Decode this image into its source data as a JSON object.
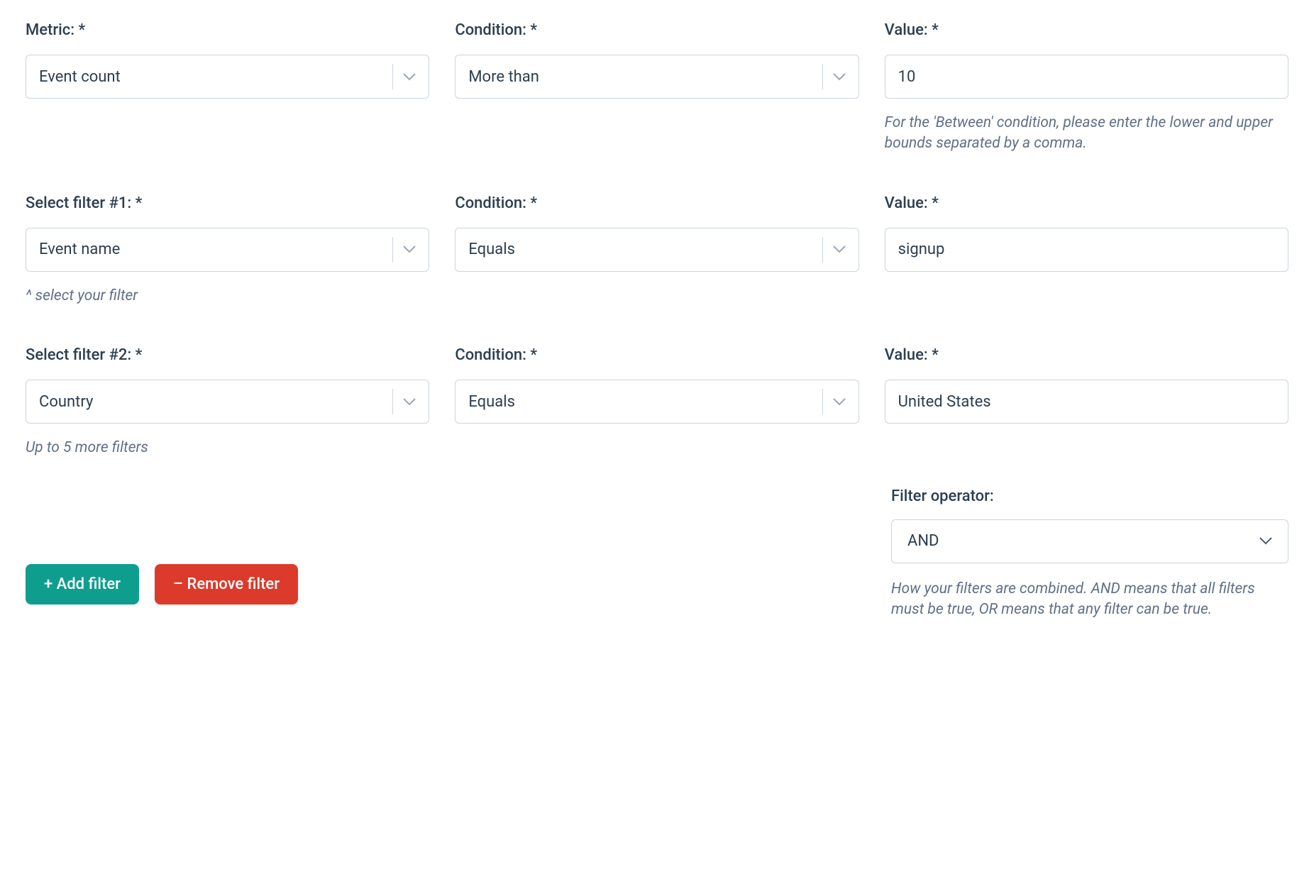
{
  "metric": {
    "label": "Metric: *",
    "value": "Event count",
    "condition_label": "Condition: *",
    "condition_value": "More than",
    "value_label": "Value: *",
    "value_input": "10",
    "value_hint": "For the 'Between' condition, please enter the lower and upper bounds separated by a comma."
  },
  "filter1": {
    "label": "Select filter #1: *",
    "value": "Event name",
    "hint": "^ select your filter",
    "condition_label": "Condition: *",
    "condition_value": "Equals",
    "value_label": "Value: *",
    "value_input": "signup"
  },
  "filter2": {
    "label": "Select filter #2: *",
    "value": "Country",
    "hint": "Up to 5 more filters",
    "condition_label": "Condition: *",
    "condition_value": "Equals",
    "value_label": "Value: *",
    "value_input": "United States"
  },
  "buttons": {
    "add": "+ Add filter",
    "remove": "– Remove filter"
  },
  "operator": {
    "label": "Filter operator:",
    "value": "AND",
    "hint": "How your filters are combined. AND means that all filters must be true, OR means that any filter can be true."
  }
}
